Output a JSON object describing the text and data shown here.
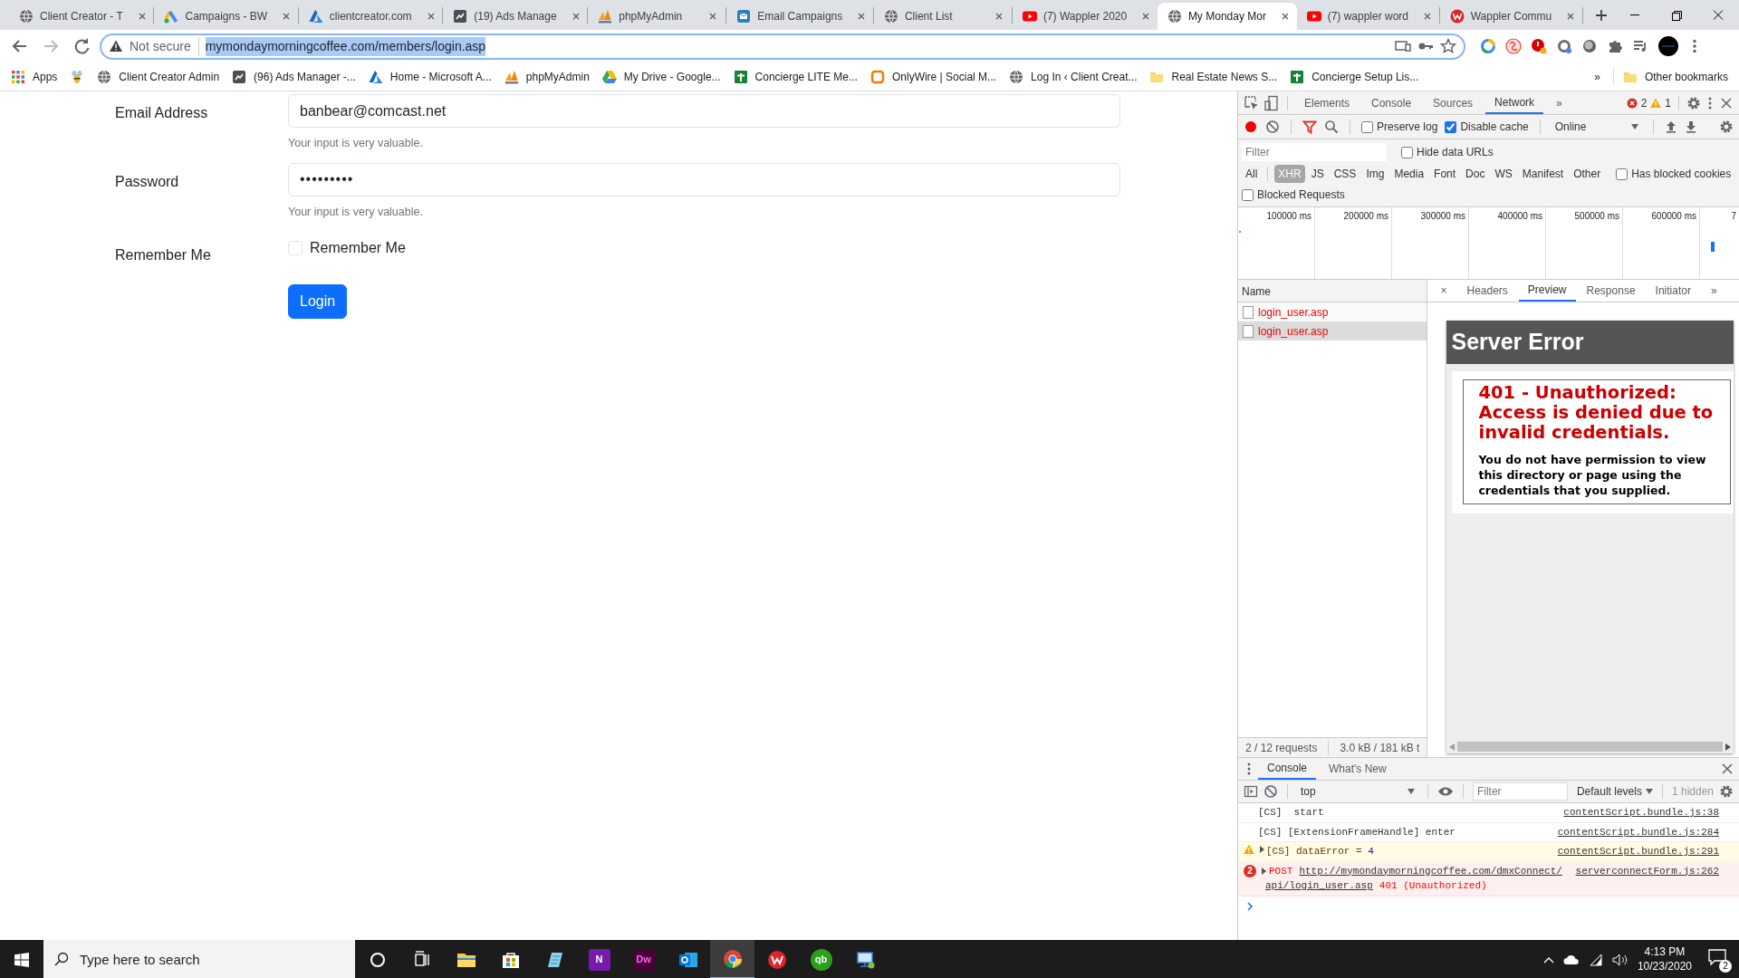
{
  "tabs": [
    {
      "title": "Client Creator - T",
      "kind": "globe",
      "selected": false
    },
    {
      "title": "Campaigns - BW",
      "kind": "ads",
      "selected": false
    },
    {
      "title": "clientcreator.com",
      "kind": "azure",
      "selected": false
    },
    {
      "title": "(19) Ads Manage",
      "kind": "chart",
      "selected": false
    },
    {
      "title": "phpMyAdmin",
      "kind": "sails",
      "selected": false
    },
    {
      "title": "Email Campaigns",
      "kind": "mail",
      "selected": false
    },
    {
      "title": "Client List",
      "kind": "globe",
      "selected": false
    },
    {
      "title": "(7) Wappler 2020",
      "kind": "play",
      "selected": false
    },
    {
      "title": "My Monday Mor",
      "kind": "globe",
      "selected": true
    },
    {
      "title": "(7) wappler word",
      "kind": "play",
      "selected": false
    },
    {
      "title": "Wappler Commu",
      "kind": "swirl",
      "selected": false
    }
  ],
  "toolbar": {
    "security": "Not secure",
    "url": "mymondaymorningcoffee.com/members/login.asp",
    "url_selected": true
  },
  "bookmarks": [
    {
      "title": "Apps",
      "kind": "apps"
    },
    {
      "kind": "bee"
    },
    {
      "title": "Client Creator Admin",
      "kind": "globe"
    },
    {
      "title": "(96) Ads Manager -...",
      "kind": "chart"
    },
    {
      "title": "Home - Microsoft A...",
      "kind": "azure"
    },
    {
      "title": "phpMyAdmin",
      "kind": "sails"
    },
    {
      "title": "My Drive - Google...",
      "kind": "drive"
    },
    {
      "title": "Concierge LITE Me...",
      "kind": "sheet"
    },
    {
      "title": "OnlyWire | Social M...",
      "kind": "square"
    },
    {
      "title": "Log In ‹ Client Creat...",
      "kind": "globe"
    },
    {
      "title": "Real Estate News S...",
      "kind": "folder"
    },
    {
      "title": "Concierge Setup Lis...",
      "kind": "sheet"
    }
  ],
  "bookmarks_more": "»",
  "other_bookmarks": "Other bookmarks",
  "form": {
    "fields": [
      {
        "label": "Email Address",
        "kind": "text",
        "value": "banbear@comcast.net",
        "help": "Your input is very valuable."
      },
      {
        "label": "Password",
        "kind": "password",
        "value": "•••••••••",
        "help": "Your input is very valuable."
      }
    ],
    "remember": {
      "label": "Remember Me",
      "option": "Remember Me",
      "checked": false
    },
    "submit": "Login"
  },
  "devtools": {
    "panels": [
      {
        "label": "Elements",
        "selected": false
      },
      {
        "label": "Console",
        "selected": false
      },
      {
        "label": "Sources",
        "selected": false
      },
      {
        "label": "Network",
        "selected": true
      }
    ],
    "panels_more": "»",
    "errors": "2",
    "warnings": "1",
    "network": {
      "preserve_log": {
        "label": "Preserve log",
        "checked": false
      },
      "disable_cache": {
        "label": "Disable cache",
        "checked": true
      },
      "throttling": "Online"
    },
    "filter": {
      "placeholder": "Filter",
      "hide_data_urls": {
        "label": "Hide data URLs",
        "checked": false
      },
      "types": [
        {
          "label": "All",
          "selected": false
        },
        {
          "label": "XHR",
          "selected": true
        },
        {
          "label": "JS",
          "selected": false
        },
        {
          "label": "CSS",
          "selected": false
        },
        {
          "label": "Img",
          "selected": false
        },
        {
          "label": "Media",
          "selected": false
        },
        {
          "label": "Font",
          "selected": false
        },
        {
          "label": "Doc",
          "selected": false
        },
        {
          "label": "WS",
          "selected": false
        },
        {
          "label": "Manifest",
          "selected": false
        },
        {
          "label": "Other",
          "selected": false
        }
      ],
      "has_blocked_cookies": {
        "label": "Has blocked cookies",
        "checked": false
      },
      "blocked_requests": {
        "label": "Blocked Requests",
        "checked": false
      }
    },
    "overview": {
      "ticks": [
        "100000 ms",
        "200000 ms",
        "300000 ms",
        "400000 ms",
        "500000 ms",
        "600000 ms",
        "7"
      ]
    },
    "requests": {
      "column": "Name",
      "rows": [
        {
          "name": "login_user.asp",
          "selected": false
        },
        {
          "name": "login_user.asp",
          "selected": true
        }
      ],
      "summary": "2 / 12 requests",
      "transferred": "3.0 kB / 181 kB t"
    },
    "detail": {
      "close": "×",
      "tabs": [
        {
          "label": "Headers",
          "selected": false
        },
        {
          "label": "Preview",
          "selected": true
        },
        {
          "label": "Response",
          "selected": false
        },
        {
          "label": "Initiator",
          "selected": false
        }
      ],
      "more": "»"
    },
    "preview": {
      "title": "Server Error",
      "heading": "401 - Unauthorized: Access is denied due to invalid credentials.",
      "message": "You do not have permission to view this directory or page using the credentials that you supplied."
    },
    "drawer": {
      "tabs": [
        {
          "label": "Console",
          "selected": true
        },
        {
          "label": "What's New",
          "selected": false
        }
      ],
      "context": "top",
      "filter_placeholder": "Filter",
      "levels": "Default levels",
      "hidden": "1 hidden",
      "messages": [
        {
          "kind": "log",
          "text": "[CS]  start",
          "source": "contentScript.bundle.js:38"
        },
        {
          "kind": "log",
          "text": "[CS] [ExtensionFrameHandle] enter",
          "source": "contentScript.bundle.js:284"
        },
        {
          "kind": "warning",
          "text": "[CS] dataError = ",
          "value": "4",
          "source": "contentScript.bundle.js:291"
        },
        {
          "kind": "error",
          "count": "2",
          "method": "POST",
          "url_lines": [
            "http://mymondaymorningcoffee.com/dmxConnect/",
            "api/login_user.asp"
          ],
          "status": "401 (Unauthorized)",
          "source": "serverconnectForm.js:262"
        }
      ]
    }
  },
  "taskbar": {
    "search_placeholder": "Type here to search",
    "apps": [
      {
        "kind": "cortana",
        "selected": false
      },
      {
        "kind": "taskview",
        "selected": false
      },
      {
        "kind": "explorer",
        "selected": false
      },
      {
        "kind": "store",
        "selected": false
      },
      {
        "kind": "pad",
        "selected": false
      },
      {
        "kind": "onenote",
        "label": "N",
        "selected": false
      },
      {
        "kind": "dw",
        "label": "Dw",
        "selected": false
      },
      {
        "kind": "outlook",
        "selected": false
      },
      {
        "kind": "chrome",
        "selected": true
      },
      {
        "kind": "swirl",
        "selected": false
      },
      {
        "kind": "qb",
        "label": "qb",
        "selected": false
      },
      {
        "kind": "remote",
        "selected": false
      }
    ],
    "time": "4:13 PM",
    "date": "10/23/2020",
    "notifications": "2"
  }
}
